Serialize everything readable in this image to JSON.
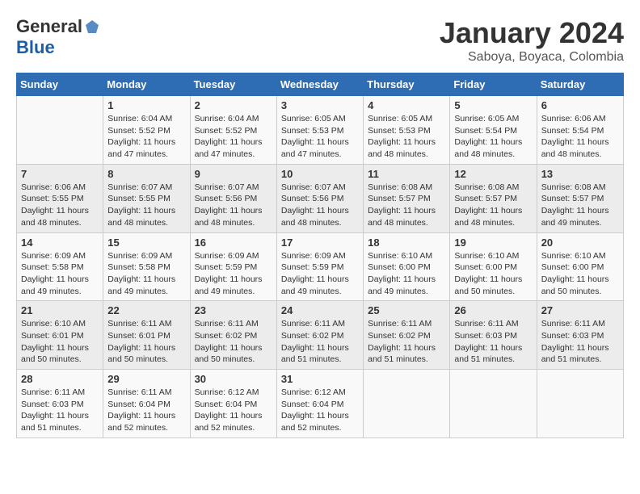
{
  "header": {
    "logo_general": "General",
    "logo_blue": "Blue",
    "month_title": "January 2024",
    "subtitle": "Saboya, Boyaca, Colombia"
  },
  "weekdays": [
    "Sunday",
    "Monday",
    "Tuesday",
    "Wednesday",
    "Thursday",
    "Friday",
    "Saturday"
  ],
  "weeks": [
    [
      {
        "day": "",
        "info": ""
      },
      {
        "day": "1",
        "info": "Sunrise: 6:04 AM\nSunset: 5:52 PM\nDaylight: 11 hours\nand 47 minutes."
      },
      {
        "day": "2",
        "info": "Sunrise: 6:04 AM\nSunset: 5:52 PM\nDaylight: 11 hours\nand 47 minutes."
      },
      {
        "day": "3",
        "info": "Sunrise: 6:05 AM\nSunset: 5:53 PM\nDaylight: 11 hours\nand 47 minutes."
      },
      {
        "day": "4",
        "info": "Sunrise: 6:05 AM\nSunset: 5:53 PM\nDaylight: 11 hours\nand 48 minutes."
      },
      {
        "day": "5",
        "info": "Sunrise: 6:05 AM\nSunset: 5:54 PM\nDaylight: 11 hours\nand 48 minutes."
      },
      {
        "day": "6",
        "info": "Sunrise: 6:06 AM\nSunset: 5:54 PM\nDaylight: 11 hours\nand 48 minutes."
      }
    ],
    [
      {
        "day": "7",
        "info": "Sunrise: 6:06 AM\nSunset: 5:55 PM\nDaylight: 11 hours\nand 48 minutes."
      },
      {
        "day": "8",
        "info": "Sunrise: 6:07 AM\nSunset: 5:55 PM\nDaylight: 11 hours\nand 48 minutes."
      },
      {
        "day": "9",
        "info": "Sunrise: 6:07 AM\nSunset: 5:56 PM\nDaylight: 11 hours\nand 48 minutes."
      },
      {
        "day": "10",
        "info": "Sunrise: 6:07 AM\nSunset: 5:56 PM\nDaylight: 11 hours\nand 48 minutes."
      },
      {
        "day": "11",
        "info": "Sunrise: 6:08 AM\nSunset: 5:57 PM\nDaylight: 11 hours\nand 48 minutes."
      },
      {
        "day": "12",
        "info": "Sunrise: 6:08 AM\nSunset: 5:57 PM\nDaylight: 11 hours\nand 48 minutes."
      },
      {
        "day": "13",
        "info": "Sunrise: 6:08 AM\nSunset: 5:57 PM\nDaylight: 11 hours\nand 49 minutes."
      }
    ],
    [
      {
        "day": "14",
        "info": "Sunrise: 6:09 AM\nSunset: 5:58 PM\nDaylight: 11 hours\nand 49 minutes."
      },
      {
        "day": "15",
        "info": "Sunrise: 6:09 AM\nSunset: 5:58 PM\nDaylight: 11 hours\nand 49 minutes."
      },
      {
        "day": "16",
        "info": "Sunrise: 6:09 AM\nSunset: 5:59 PM\nDaylight: 11 hours\nand 49 minutes."
      },
      {
        "day": "17",
        "info": "Sunrise: 6:09 AM\nSunset: 5:59 PM\nDaylight: 11 hours\nand 49 minutes."
      },
      {
        "day": "18",
        "info": "Sunrise: 6:10 AM\nSunset: 6:00 PM\nDaylight: 11 hours\nand 49 minutes."
      },
      {
        "day": "19",
        "info": "Sunrise: 6:10 AM\nSunset: 6:00 PM\nDaylight: 11 hours\nand 50 minutes."
      },
      {
        "day": "20",
        "info": "Sunrise: 6:10 AM\nSunset: 6:00 PM\nDaylight: 11 hours\nand 50 minutes."
      }
    ],
    [
      {
        "day": "21",
        "info": "Sunrise: 6:10 AM\nSunset: 6:01 PM\nDaylight: 11 hours\nand 50 minutes."
      },
      {
        "day": "22",
        "info": "Sunrise: 6:11 AM\nSunset: 6:01 PM\nDaylight: 11 hours\nand 50 minutes."
      },
      {
        "day": "23",
        "info": "Sunrise: 6:11 AM\nSunset: 6:02 PM\nDaylight: 11 hours\nand 50 minutes."
      },
      {
        "day": "24",
        "info": "Sunrise: 6:11 AM\nSunset: 6:02 PM\nDaylight: 11 hours\nand 51 minutes."
      },
      {
        "day": "25",
        "info": "Sunrise: 6:11 AM\nSunset: 6:02 PM\nDaylight: 11 hours\nand 51 minutes."
      },
      {
        "day": "26",
        "info": "Sunrise: 6:11 AM\nSunset: 6:03 PM\nDaylight: 11 hours\nand 51 minutes."
      },
      {
        "day": "27",
        "info": "Sunrise: 6:11 AM\nSunset: 6:03 PM\nDaylight: 11 hours\nand 51 minutes."
      }
    ],
    [
      {
        "day": "28",
        "info": "Sunrise: 6:11 AM\nSunset: 6:03 PM\nDaylight: 11 hours\nand 51 minutes."
      },
      {
        "day": "29",
        "info": "Sunrise: 6:11 AM\nSunset: 6:04 PM\nDaylight: 11 hours\nand 52 minutes."
      },
      {
        "day": "30",
        "info": "Sunrise: 6:12 AM\nSunset: 6:04 PM\nDaylight: 11 hours\nand 52 minutes."
      },
      {
        "day": "31",
        "info": "Sunrise: 6:12 AM\nSunset: 6:04 PM\nDaylight: 11 hours\nand 52 minutes."
      },
      {
        "day": "",
        "info": ""
      },
      {
        "day": "",
        "info": ""
      },
      {
        "day": "",
        "info": ""
      }
    ]
  ]
}
